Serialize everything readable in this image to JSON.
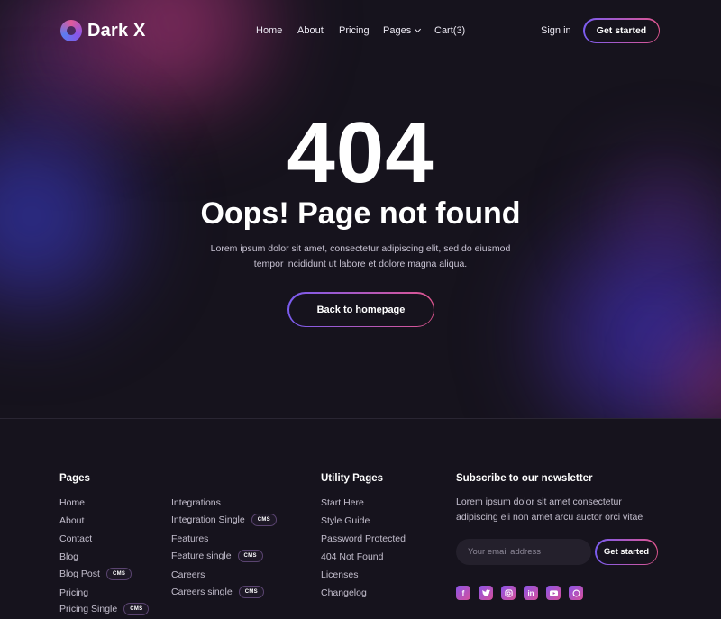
{
  "brand": {
    "name": "Dark X"
  },
  "nav": {
    "links": [
      "Home",
      "About",
      "Pricing",
      "Pages",
      "Cart(3)"
    ],
    "sign_in": "Sign in",
    "cta": "Get started"
  },
  "hero": {
    "code": "404",
    "title": "Oops! Page not found",
    "description": "Lorem ipsum dolor sit amet, consectetur adipiscing elit, sed do eiusmod tempor incididunt ut labore et dolore magna aliqua.",
    "button": "Back to homepage"
  },
  "footer": {
    "pages": {
      "heading": "Pages",
      "col1": [
        {
          "label": "Home",
          "badge": ""
        },
        {
          "label": "About",
          "badge": ""
        },
        {
          "label": "Contact",
          "badge": ""
        },
        {
          "label": "Blog",
          "badge": ""
        },
        {
          "label": "Blog Post",
          "badge": "CMS"
        },
        {
          "label": "Pricing",
          "badge": ""
        },
        {
          "label": "Pricing Single",
          "badge": "CMS"
        }
      ],
      "col2": [
        {
          "label": "Integrations",
          "badge": ""
        },
        {
          "label": "Integration Single",
          "badge": "CMS"
        },
        {
          "label": "Features",
          "badge": ""
        },
        {
          "label": "Feature single",
          "badge": "CMS"
        },
        {
          "label": "Careers",
          "badge": ""
        },
        {
          "label": "Careers single",
          "badge": "CMS"
        }
      ]
    },
    "utility": {
      "heading": "Utility Pages",
      "links": [
        "Start Here",
        "Style Guide",
        "Password Protected",
        "404 Not Found",
        "Licenses",
        "Changelog"
      ]
    },
    "newsletter": {
      "heading": "Subscribe to our newsletter",
      "text": "Lorem ipsum dolor sit amet consectetur adipiscing eli non amet arcu auctor orci vitae",
      "placeholder": "Your email address",
      "button": "Get started"
    },
    "socials": [
      "facebook-icon",
      "twitter-icon",
      "instagram-icon",
      "linkedin-icon",
      "youtube-icon",
      "whatsapp-icon"
    ]
  },
  "colors": {
    "background": "#16131d",
    "accent_start": "#7a5cf0",
    "accent_end": "#e0558f"
  }
}
